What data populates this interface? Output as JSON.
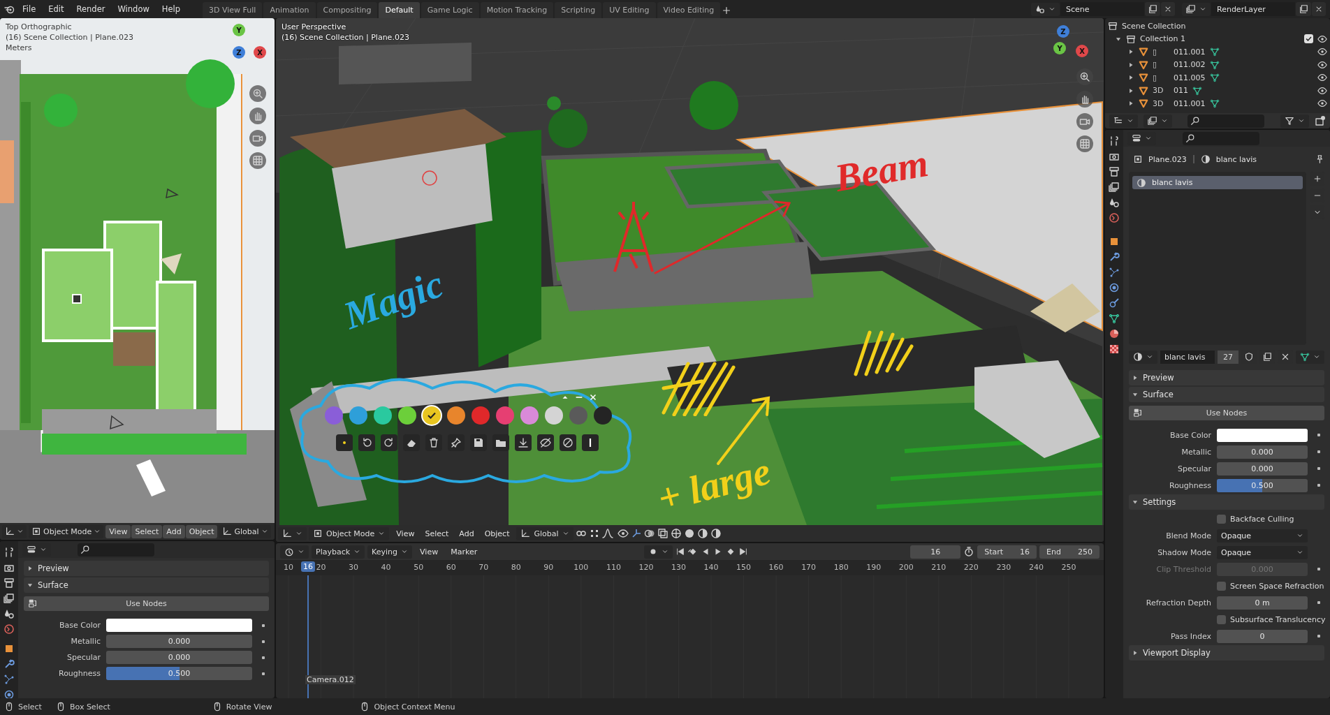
{
  "topbar": {
    "menus": [
      "File",
      "Edit",
      "Render",
      "Window",
      "Help"
    ],
    "workspaces": [
      {
        "label": "3D View Full",
        "selected": false
      },
      {
        "label": "Animation",
        "selected": false
      },
      {
        "label": "Compositing",
        "selected": false
      },
      {
        "label": "Default",
        "selected": true
      },
      {
        "label": "Game Logic",
        "selected": false
      },
      {
        "label": "Motion Tracking",
        "selected": false
      },
      {
        "label": "Scripting",
        "selected": false
      },
      {
        "label": "UV Editing",
        "selected": false
      },
      {
        "label": "Video Editing",
        "selected": false
      }
    ],
    "scene": "Scene",
    "view_layer": "RenderLayer"
  },
  "left_viewport": {
    "overlay_lines": [
      "Top Orthographic",
      "(16) Scene Collection | Plane.023",
      "Meters"
    ],
    "axes": [
      "Y",
      "Z",
      "X"
    ],
    "header": {
      "mode": "Object Mode",
      "menus": [
        "View",
        "Select",
        "Add",
        "Object"
      ],
      "orientation": "Global"
    }
  },
  "left_properties": {
    "rows": [
      {
        "kind": "panel",
        "title": "Preview",
        "expanded": false
      },
      {
        "kind": "panel",
        "title": "Surface",
        "expanded": true
      },
      {
        "kind": "button",
        "label": "Use Nodes"
      },
      {
        "kind": "color",
        "label": "Base Color",
        "color": "#ffffff"
      },
      {
        "kind": "number",
        "label": "Metallic",
        "value": "0.000",
        "disabled": false
      },
      {
        "kind": "number",
        "label": "Specular",
        "value": "0.000",
        "disabled": false
      },
      {
        "kind": "slider",
        "label": "Roughness",
        "value": "0.500",
        "level": 0.5
      }
    ]
  },
  "viewport": {
    "overlay_lines": [
      "User Perspective",
      "(16) Scene Collection | Plane.023"
    ],
    "axes": [
      "Z",
      "Y",
      "X"
    ],
    "annotations": [
      {
        "text": "Magic",
        "color": "#2aa9e0"
      },
      {
        "text": "Beam",
        "color": "#e02a2a"
      },
      {
        "text": "+ large",
        "color": "#f2d01a"
      }
    ],
    "palette": {
      "swatches": [
        {
          "color": "#8a5ed8",
          "selected": false
        },
        {
          "color": "#2e9fd9",
          "selected": false
        },
        {
          "color": "#2ac99f",
          "selected": false
        },
        {
          "color": "#6ccf3a",
          "selected": false
        },
        {
          "color": "#e8c520",
          "selected": true
        },
        {
          "color": "#e8852c",
          "selected": false
        },
        {
          "color": "#e0282a",
          "selected": false
        },
        {
          "color": "#e63f72",
          "selected": false
        },
        {
          "color": "#d98ad8",
          "selected": false
        },
        {
          "color": "#d4d4d4",
          "selected": false
        },
        {
          "color": "#5a5a5a",
          "selected": false
        },
        {
          "color": "#242424",
          "selected": false
        }
      ]
    },
    "header": {
      "mode": "Object Mode",
      "menus": [
        "View",
        "Select",
        "Add",
        "Object"
      ],
      "orientation": "Global"
    }
  },
  "timeline": {
    "menus": [
      "Playback",
      "Keying",
      "View",
      "Marker"
    ],
    "current_frame": "16",
    "start_label": "Start",
    "start": "16",
    "end_label": "End",
    "end": "250",
    "ruler": [
      "10",
      "20",
      "30",
      "40",
      "50",
      "60",
      "70",
      "80",
      "90",
      "100",
      "110",
      "120",
      "130",
      "140",
      "150",
      "160",
      "170",
      "180",
      "190",
      "200",
      "210",
      "220",
      "230",
      "240",
      "250"
    ],
    "playhead": "16",
    "marker": "Camera.012"
  },
  "outliner": {
    "root": "Scene Collection",
    "collections": [
      {
        "name": "Collection 1",
        "checked": true,
        "expanded": true,
        "children": [
          {
            "prefix": "▯",
            "name": "011.001",
            "expanded": false
          },
          {
            "prefix": "▯",
            "name": "011.002",
            "expanded": false
          },
          {
            "prefix": "▯",
            "name": "011.005",
            "expanded": false
          },
          {
            "prefix": "3D",
            "name": "011",
            "expanded": false
          },
          {
            "prefix": "3D",
            "name": "011.001",
            "expanded": false
          }
        ]
      }
    ]
  },
  "properties": {
    "breadcrumb": [
      "Plane.023",
      "blanc lavis"
    ],
    "slots": [
      {
        "name": "blanc lavis",
        "selected": true
      }
    ],
    "material": {
      "name": "blanc lavis",
      "users": "27"
    },
    "rows": [
      {
        "kind": "panel",
        "title": "Preview",
        "expanded": false
      },
      {
        "kind": "panel",
        "title": "Surface",
        "expanded": true
      },
      {
        "kind": "button",
        "label": "Use Nodes"
      },
      {
        "kind": "color",
        "label": "Base Color",
        "color": "#ffffff"
      },
      {
        "kind": "number",
        "label": "Metallic",
        "value": "0.000",
        "disabled": false
      },
      {
        "kind": "number",
        "label": "Specular",
        "value": "0.000",
        "disabled": false
      },
      {
        "kind": "slider",
        "label": "Roughness",
        "value": "0.500",
        "level": 0.5
      },
      {
        "kind": "panel",
        "title": "Settings",
        "expanded": true
      },
      {
        "kind": "checkbox",
        "label": "Backface Culling",
        "checked": false
      },
      {
        "kind": "dropdown",
        "label": "Blend Mode",
        "value": "Opaque"
      },
      {
        "kind": "dropdown",
        "label": "Shadow Mode",
        "value": "Opaque"
      },
      {
        "kind": "number",
        "label": "Clip Threshold",
        "value": "0.000",
        "disabled": true
      },
      {
        "kind": "checkbox",
        "label": "Screen Space Refraction",
        "checked": false
      },
      {
        "kind": "number",
        "label": "Refraction Depth",
        "value": "0 m",
        "disabled": false
      },
      {
        "kind": "checkbox",
        "label": "Subsurface Translucency",
        "checked": false
      },
      {
        "kind": "number",
        "label": "Pass Index",
        "value": "0",
        "disabled": false
      },
      {
        "kind": "panel",
        "title": "Viewport Display",
        "expanded": false
      }
    ]
  },
  "status_bar": [
    "Select",
    "Box Select",
    "Rotate View",
    "Object Context Menu"
  ]
}
